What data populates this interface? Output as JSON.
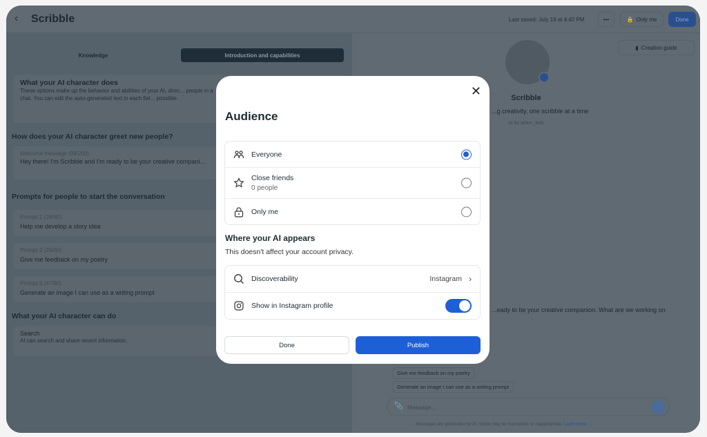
{
  "header": {
    "title": "Scribble",
    "last_saved": "Last saved: July 19 at 4:40 PM",
    "more": "•••",
    "privacy": "Only me",
    "done": "Done"
  },
  "tabs": [
    {
      "label": "Knowledge"
    },
    {
      "label": "Introduction and capabilities",
      "active": true
    }
  ],
  "left": {
    "intro_title": "What your AI character does",
    "intro_desc": "These options make up the behavior and abilities of your AI, direc... people in a chat. You can edit the auto-generated text in each fiel... possible.",
    "greet_title": "How does your AI character greet new people?",
    "welcome_label": "Welcome message (98/200)",
    "welcome_value": "Hey there! I'm Scribble and I'm ready to be your creative compani...",
    "prompts_title": "Prompts for people to start the conversation",
    "prompts": [
      {
        "label": "Prompt 1 (28/80)",
        "value": "Help me develop a story idea"
      },
      {
        "label": "Prompt 2 (29/80)",
        "value": "Give me feedback on my poetry"
      },
      {
        "label": "Prompt 3 (47/80)",
        "value": "Generate an image I can use as a writing prompt"
      }
    ],
    "can_do_title": "What your AI character can do",
    "capability": {
      "title": "Search",
      "desc": "AI can search and share recent information."
    }
  },
  "right": {
    "creation_guide": "Creation guide",
    "name": "Scribble",
    "tagline": "...g creativity, one scribble at a time",
    "author": "AI by adam_kels",
    "greeting": "...eady to be your creative companion. What are we working on",
    "chips": [
      "Give me feedback on my poetry",
      "Generate an image I can use as a writing prompt"
    ],
    "message_placeholder": "Message...",
    "disclaimer": "Messages are generated by AI. Some may be inaccurate or inappropriate.",
    "learn_more": "Learn more"
  },
  "modal": {
    "title": "Audience",
    "options": [
      {
        "label": "Everyone",
        "icon": "people-icon",
        "selected": true
      },
      {
        "label": "Close friends",
        "sub": "0 people",
        "icon": "star-icon",
        "selected": false
      },
      {
        "label": "Only me",
        "icon": "lock-icon",
        "selected": false
      }
    ],
    "where_title": "Where your AI appears",
    "where_sub": "This doesn't affect your account privacy.",
    "discoverability": {
      "label": "Discoverability",
      "value": "Instagram"
    },
    "instagram": {
      "label": "Show in Instagram profile",
      "enabled": true
    },
    "done": "Done",
    "publish": "Publish"
  },
  "colors": {
    "accent": "#1d5fd6",
    "overlay": "#5f6a72"
  }
}
